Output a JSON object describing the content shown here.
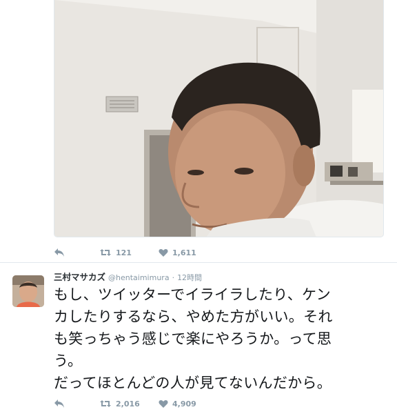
{
  "photo_tweet": {
    "actions": {
      "reply_icon": "reply-arrow-icon",
      "retweet_icon": "retweet-icon",
      "retweet_count": "121",
      "like_icon": "heart-icon",
      "like_count": "1,611"
    }
  },
  "text_tweet": {
    "display_name": "三村マサカズ",
    "handle": "@hentaimimura",
    "separator": "·",
    "timestamp": "12時間",
    "text_lines": [
      "もし、ツイッターでイライラしたり、ケン",
      "カしたりするなら、やめた方がいい。それ",
      "も笑っちゃう感じで楽にやろうか。って思",
      "う。",
      "だってほとんどの人が見てないんだから。"
    ],
    "actions": {
      "reply_icon": "reply-arrow-icon",
      "retweet_icon": "retweet-icon",
      "retweet_count": "2,016",
      "like_icon": "heart-icon",
      "like_count": "4,909"
    }
  },
  "colors": {
    "icon_gray": "#8899a6",
    "border": "#e1e8ed",
    "text": "#292f33"
  }
}
